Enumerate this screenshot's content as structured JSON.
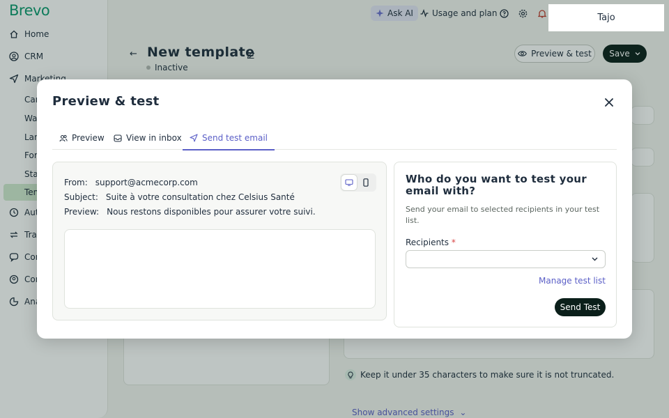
{
  "app": {
    "brand": "Brevo"
  },
  "sidebar": {
    "items": [
      {
        "label": "Home",
        "icon": "home-icon"
      },
      {
        "label": "CRM",
        "icon": "contacts-circle-icon"
      },
      {
        "label": "Marketing",
        "icon": "send-icon"
      },
      {
        "label": "Can"
      },
      {
        "label": "Wal"
      },
      {
        "label": "Lan"
      },
      {
        "label": "For"
      },
      {
        "label": "Sta"
      },
      {
        "label": "Tem"
      },
      {
        "label": "Aut",
        "icon": "automation-icon"
      },
      {
        "label": "Tra",
        "icon": "transactional-icon"
      },
      {
        "label": "Con",
        "icon": "conversations-icon"
      },
      {
        "label": "Con",
        "icon": "contacts-icon"
      },
      {
        "label": "Ana",
        "icon": "analytics-icon"
      }
    ]
  },
  "topbar": {
    "ask_ai": "Ask AI",
    "usage": "Usage and plan",
    "user": "Tajo"
  },
  "page": {
    "title": "New template",
    "status": "Inactive",
    "preview_test_label": "Preview & test",
    "save_label": "Save",
    "tip": "Keep it under 35 characters to make sure it is not truncated.",
    "advanced": "Show advanced settings"
  },
  "modal": {
    "title": "Preview & test",
    "tabs": [
      {
        "label": "Preview"
      },
      {
        "label": "View in inbox"
      },
      {
        "label": "Send test email"
      }
    ],
    "active_tab": "Send test email",
    "email": {
      "from_label": "From:",
      "from": "support@acmecorp.com",
      "subject_label": "Subject:",
      "subject": "Suite à votre consultation chez Celsius Santé",
      "preview_label": "Preview:",
      "preview": "Nous restons disponibles pour assurer votre suivi."
    },
    "test": {
      "title": "Who do you want to test your email with?",
      "description": "Send your email to selected recipients in your test list.",
      "recipients_label": "Recipients",
      "required_mark": "*",
      "recipients_value": "",
      "manage_link": "Manage test list",
      "send_label": "Send Test"
    }
  },
  "colors": {
    "accent": "#5b5fc7",
    "brand": "#0b996e",
    "primary_button": "#0b1f1a"
  }
}
